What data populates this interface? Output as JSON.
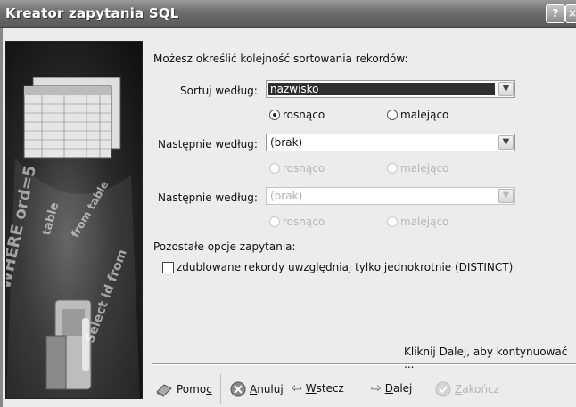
{
  "window": {
    "title": "Kreator zapytania SQL",
    "help_btn": "?",
    "close_btn": "×"
  },
  "intro": "Możesz określić kolejność sortowania rekordów:",
  "sort1": {
    "label": "Sortuj według:",
    "value": "nazwisko",
    "asc": "rosnąco",
    "desc": "malejąco",
    "selected": "asc"
  },
  "sort2": {
    "label": "Następnie według:",
    "value": "(brak)",
    "asc": "rosnąco",
    "desc": "malejąco"
  },
  "sort3": {
    "label": "Następnie według:",
    "value": "(brak)",
    "asc": "rosnąco",
    "desc": "malejąco"
  },
  "other": {
    "label": "Pozostałe opcje zapytania:",
    "distinct": "zdublowane rekordy uwzględniaj tylko jednokrotnie (DISTINCT)"
  },
  "hint": "Kliknij Dalej, aby kontynuować ...",
  "buttons": {
    "help": {
      "pre": "Pomo",
      "acc": "c"
    },
    "cancel": {
      "acc": "A",
      "post": "nuluj"
    },
    "back": {
      "acc": "W",
      "post": "stecz"
    },
    "next": {
      "acc": "D",
      "post": "alej"
    },
    "finish": {
      "acc": "Z",
      "post": "akończ"
    }
  },
  "side_words": [
    "WHERE ord=5",
    "Select id from",
    "table",
    "from table"
  ]
}
